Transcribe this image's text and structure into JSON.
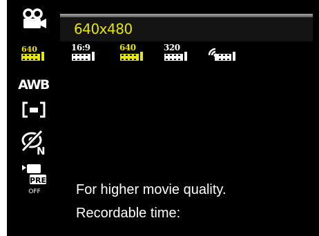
{
  "sidebar": {
    "items": [
      {
        "name": "movie-mode",
        "icon": "movie-camera-icon",
        "selected": false
      },
      {
        "name": "movie-size",
        "icon": "film-640-icon",
        "label": "640",
        "selected": true
      },
      {
        "name": "white-balance",
        "label": "AWB",
        "selected": false
      },
      {
        "name": "metering",
        "icon": "spot-metering-icon",
        "selected": false
      },
      {
        "name": "color-effect",
        "icon": "color-normal-icon",
        "label": "N",
        "selected": false
      },
      {
        "name": "pre-record",
        "icon": "pre-record-icon",
        "label": "PRE",
        "sublabel": "OFF",
        "selected": false
      }
    ]
  },
  "panel": {
    "title": "640x480",
    "options": [
      {
        "label": "16:9",
        "icon": "film-icon",
        "selected": false
      },
      {
        "label": "640",
        "icon": "film-icon",
        "selected": true
      },
      {
        "label": "320",
        "icon": "film-icon",
        "selected": false
      },
      {
        "label": "",
        "icon": "webcam-film-icon",
        "selected": false
      }
    ]
  },
  "info": {
    "line1": "For higher movie quality.",
    "line2": "Recordable time:"
  },
  "colors": {
    "selected": "#e6e600",
    "text": "#ffffff",
    "background": "#000000"
  }
}
